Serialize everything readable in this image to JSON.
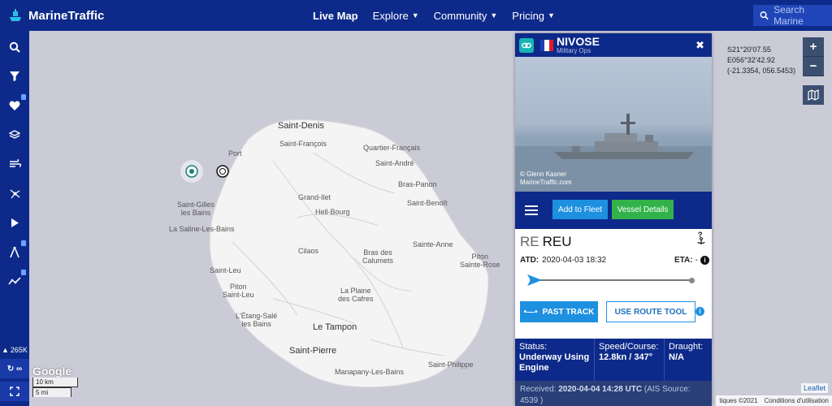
{
  "brand": {
    "name": "MarineTraffic"
  },
  "nav": {
    "items": [
      {
        "label": "Live Map",
        "active": true,
        "has_dropdown": false
      },
      {
        "label": "Explore",
        "active": false,
        "has_dropdown": true
      },
      {
        "label": "Community",
        "active": false,
        "has_dropdown": true
      },
      {
        "label": "Pricing",
        "active": false,
        "has_dropdown": true
      }
    ]
  },
  "search": {
    "placeholder": "Search Marine"
  },
  "sidebar": {
    "buttons": [
      {
        "icon": "search-icon"
      },
      {
        "icon": "filter-icon"
      },
      {
        "icon": "heart-icon",
        "locked": true
      },
      {
        "icon": "layers-icon"
      },
      {
        "icon": "wind-icon"
      },
      {
        "icon": "routes-icon"
      },
      {
        "icon": "play-icon"
      },
      {
        "icon": "compass-icon",
        "locked": true
      },
      {
        "icon": "chart-icon",
        "locked": true
      }
    ],
    "vessel_count": "265K",
    "bottom_label": "∞"
  },
  "map": {
    "places": [
      {
        "name": "Saint-Denis",
        "big": true
      },
      {
        "name": "Saint-François"
      },
      {
        "name": "Quartier-Français"
      },
      {
        "name": "Port"
      },
      {
        "name": "Saint-André"
      },
      {
        "name": "Bras-Panon"
      },
      {
        "name": "Grand-Ilet"
      },
      {
        "name": "Saint-Benoît"
      },
      {
        "name": "Saint-Gilles\nles Bains"
      },
      {
        "name": "Hell-Bourg"
      },
      {
        "name": "La Saline-Les-Bains"
      },
      {
        "name": "Sainte-Anne"
      },
      {
        "name": "Piton\nSainte-Rose"
      },
      {
        "name": "Cilaos"
      },
      {
        "name": "Bras des\nCalumets"
      },
      {
        "name": "Saint-Leu"
      },
      {
        "name": "Piton\nSaint-Leu"
      },
      {
        "name": "La Plaine\ndes Cafres"
      },
      {
        "name": "L'Étang-Salé\nles Bains"
      },
      {
        "name": "Le Tampon",
        "big": true
      },
      {
        "name": "Saint-Pierre",
        "big": true
      },
      {
        "name": "Saint-Philippe"
      },
      {
        "name": "Manapany-Les-Bains"
      }
    ],
    "coords": {
      "lat": "S21°20'07.55",
      "lon": "E056°32'42.92",
      "decimal": "(-21.3354, 056.5453)"
    },
    "scale": {
      "km": "10 km",
      "mi": "5 mi"
    },
    "google_label": "Google",
    "zoom_in": "+",
    "zoom_out": "−",
    "leaflet_label": "Leaflet",
    "attribution": [
      "tiques ©2021",
      "Conditions d'utilisation"
    ]
  },
  "vessel": {
    "name": "NIVOSE",
    "type": "Military Ops",
    "flag_colors": [
      "#1f3fb5",
      "#ffffff",
      "#e21b2a"
    ],
    "photo_credit": [
      "© Glenn Kasner",
      "MarineTraffic.com"
    ],
    "add_to_fleet": "Add to Fleet",
    "vessel_details": "Vessel Details",
    "destination": {
      "country": "RE",
      "port": "REU"
    },
    "atd_label": "ATD:",
    "atd_value": "2020-04-03 18:32",
    "eta_label": "ETA:",
    "eta_value": "-",
    "past_track": "PAST TRACK",
    "route_tool": "USE ROUTE TOOL",
    "status_label": "Status:",
    "status_value": "Underway Using Engine",
    "speed_label": "Speed/Course:",
    "speed_value": "12.8kn / 347°",
    "draught_label": "Draught:",
    "draught_value": "N/A",
    "received_label": "Received:",
    "received_value": "2020-04-04 14:28 UTC",
    "received_source": "(AIS Source: 4539 )"
  }
}
